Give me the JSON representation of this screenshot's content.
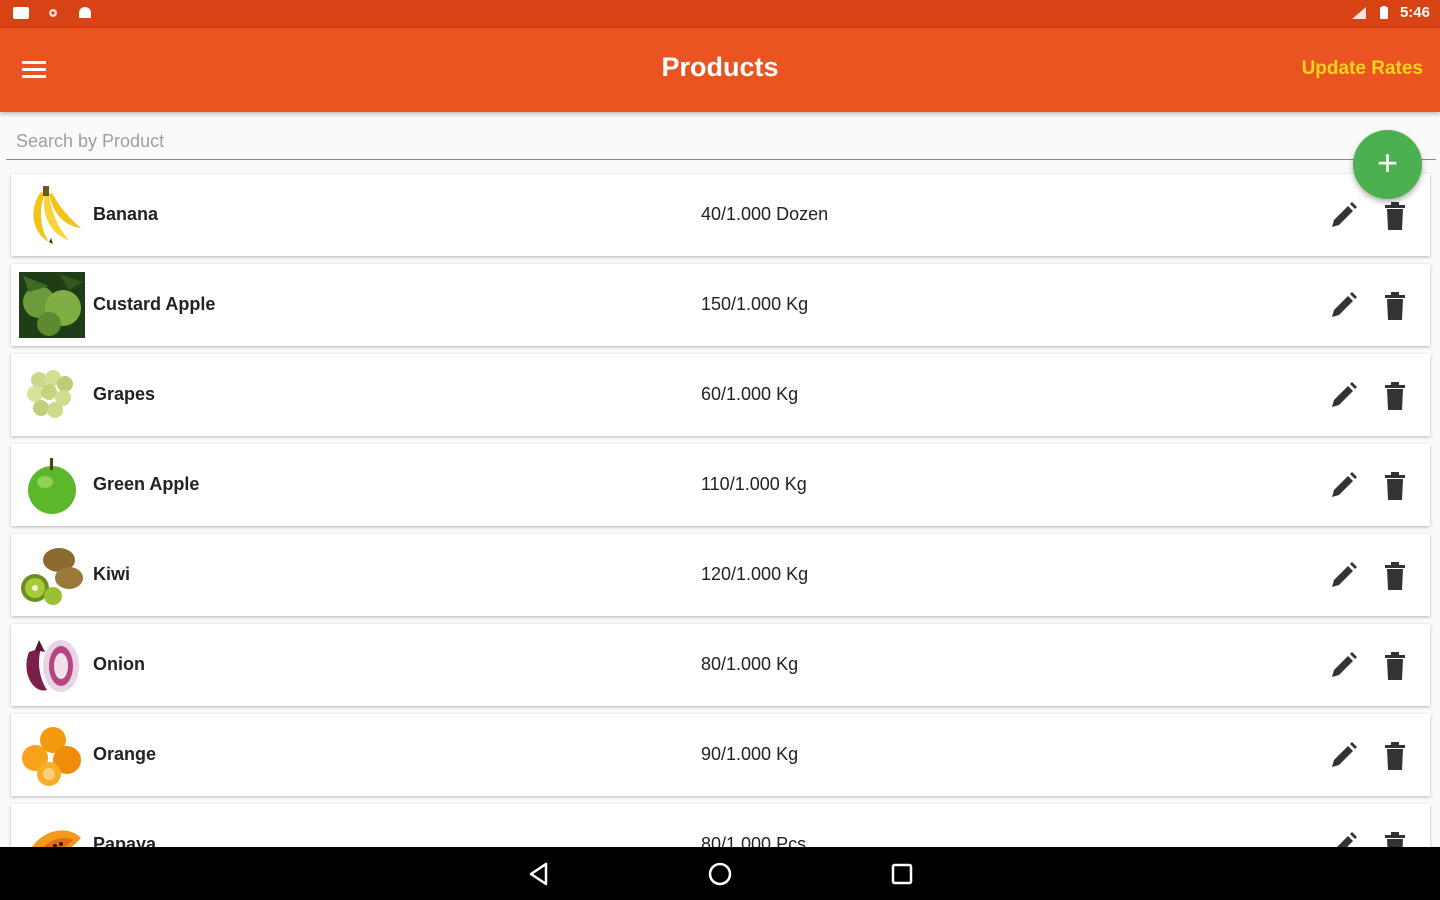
{
  "statusbar": {
    "time": "5:46"
  },
  "appbar": {
    "title": "Products",
    "action_label": "Update Rates"
  },
  "search": {
    "placeholder": "Search by Product",
    "value": ""
  },
  "fab": {
    "label": "+"
  },
  "products": [
    {
      "name": "Banana",
      "rate": "40/1.000 Dozen",
      "thumb": "banana"
    },
    {
      "name": "Custard Apple",
      "rate": "150/1.000 Kg",
      "thumb": "custard-apple"
    },
    {
      "name": "Grapes",
      "rate": "60/1.000 Kg",
      "thumb": "grapes"
    },
    {
      "name": "Green Apple",
      "rate": "110/1.000 Kg",
      "thumb": "green-apple"
    },
    {
      "name": "Kiwi",
      "rate": "120/1.000 Kg",
      "thumb": "kiwi"
    },
    {
      "name": "Onion",
      "rate": "80/1.000 Kg",
      "thumb": "onion"
    },
    {
      "name": "Orange",
      "rate": "90/1.000 Kg",
      "thumb": "orange"
    },
    {
      "name": "Papaya",
      "rate": "80/1.000 Pcs",
      "thumb": "papaya"
    }
  ],
  "colors": {
    "primary": "#e95420",
    "status": "#d84315",
    "accent": "#ffd21f",
    "fab": "#4caf50"
  },
  "icons": {
    "menu": "menu-icon",
    "edit": "pencil-icon",
    "delete": "trash-icon",
    "back": "back-icon",
    "home": "home-icon",
    "recents": "recents-icon"
  }
}
